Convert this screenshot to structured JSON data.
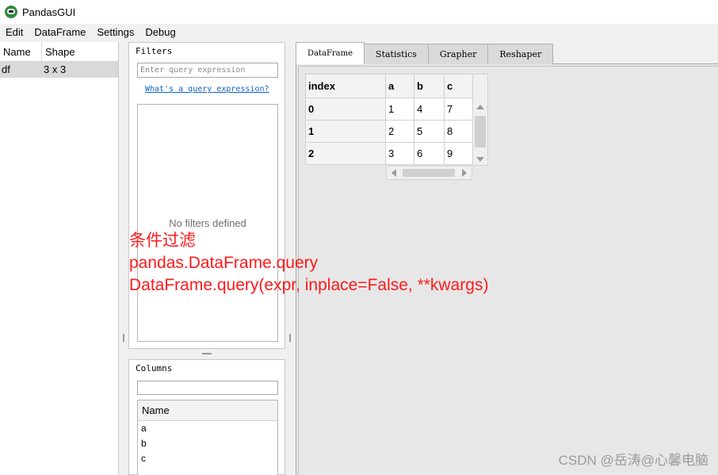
{
  "window": {
    "title": "PandasGUI"
  },
  "menu": [
    "Edit",
    "DataFrame",
    "Settings",
    "Debug"
  ],
  "dataframes_panel": {
    "headers": {
      "name": "Name",
      "shape": "Shape"
    },
    "rows": [
      {
        "name": "df",
        "shape": "3 x 3"
      }
    ]
  },
  "filters": {
    "title": "Filters",
    "placeholder": "Enter query expression",
    "link": "What's a query expression?",
    "empty_text": "No filters defined"
  },
  "columns": {
    "title": "Columns",
    "header": "Name",
    "items": [
      "a",
      "b",
      "c"
    ]
  },
  "tabs": [
    "DataFrame",
    "Statistics",
    "Grapher",
    "Reshaper"
  ],
  "table": {
    "headers": [
      "index",
      "a",
      "b",
      "c"
    ],
    "rows": [
      [
        "0",
        "1",
        "4",
        "7"
      ],
      [
        "1",
        "2",
        "5",
        "8"
      ],
      [
        "2",
        "3",
        "6",
        "9"
      ]
    ]
  },
  "annotation": {
    "line1": "条件过滤",
    "line2": "pandas.DataFrame.query",
    "line3": "DataFrame.query(expr, inplace=False, **kwargs)"
  },
  "watermark": "CSDN @岳涛@心馨电脑",
  "colors": {
    "annotation": "#ff1a1a",
    "link": "#0b63c4",
    "selected_row": "#d9d9d9"
  }
}
